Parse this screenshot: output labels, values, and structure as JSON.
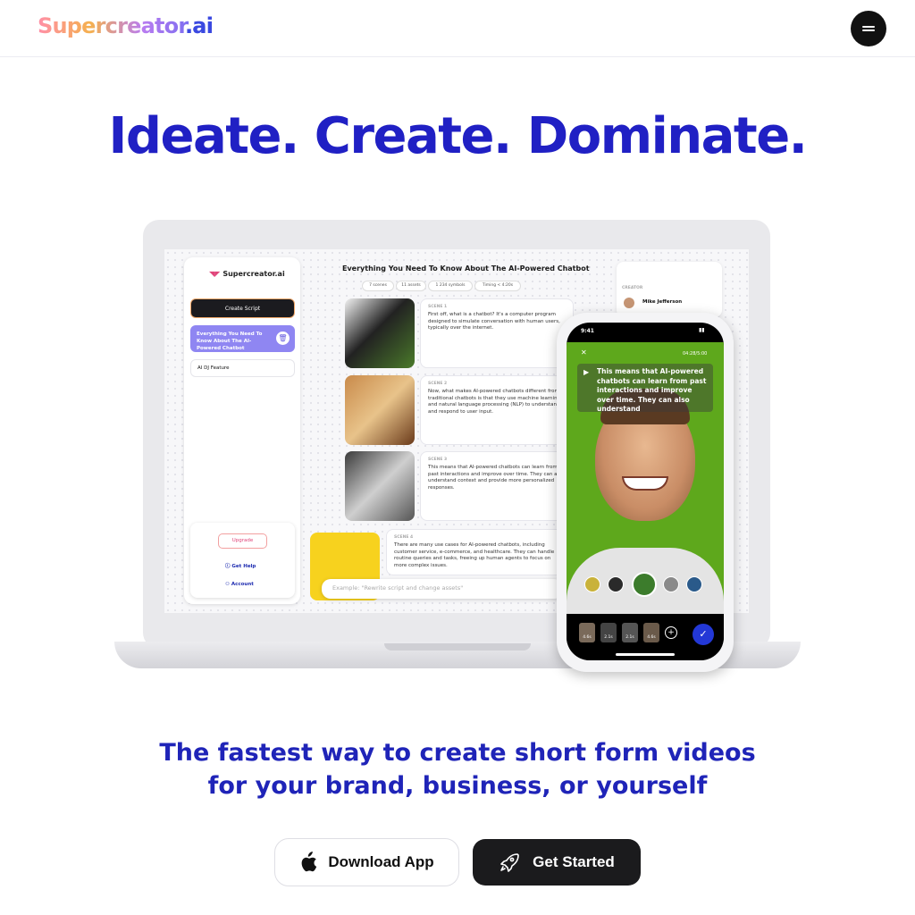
{
  "header": {
    "logo_text": "Supercreator",
    "logo_suffix": ".ai",
    "menu_icon": "hamburger-menu-icon"
  },
  "hero": {
    "title": "Ideate. Create. Dominate.",
    "subtitle_line1": "The fastest way to create short form videos",
    "subtitle_line2": "for your brand, business, or yourself"
  },
  "mockup": {
    "app_logo": "Supercreator.ai",
    "create_script": "Create Script",
    "doc_active": "Everything You Need To Know About The AI-Powered Chatbot",
    "doc_item2": "AI DJ Feature",
    "upgrade": "Upgrade",
    "get_help": "Get Help",
    "account": "Account",
    "doc_title": "Everything You Need To Know About The AI-Powered Chatbot",
    "chips": [
      "7 scenes",
      "11 assets",
      "1 234 symbols",
      "Timing < 4:20s"
    ],
    "scenes": [
      {
        "label": "SCENE 1",
        "text": "First off, what is a chatbot? It's a computer program designed to simulate conversation with human users, typically over the internet."
      },
      {
        "label": "SCENE 2",
        "text": "Now, what makes AI-powered chatbots different from traditional chatbots is that they use machine learning and natural language processing (NLP) to understand and respond to user input."
      },
      {
        "label": "SCENE 3",
        "text": "This means that AI-powered chatbots can learn from past interactions and improve over time. They can also understand context and provide more personalized responses."
      },
      {
        "label": "SCENE 4",
        "text": "There are many use cases for AI-powered chatbots, including customer service, e-commerce, and healthcare. They can handle routine queries and tasks, freeing up human agents to focus on more complex issues."
      }
    ],
    "prompt_placeholder": "Example: \"Rewrite script and change assets\"",
    "creator_label": "CREATOR",
    "creator_name": "Mike Jefferson",
    "phone_time": "9:41",
    "phone_timer": "04:28/5:00",
    "phone_caption": "This means that AI-powered chatbots can learn from past interactions and improve over time. They can also understand",
    "clip_durations": [
      "4.6s",
      "2.1s",
      "2.1s",
      "4.6s"
    ]
  },
  "actions": {
    "download_label": "Download App",
    "download_icon": "apple-logo-icon",
    "start_label": "Get Started",
    "start_icon": "rocket-icon"
  }
}
